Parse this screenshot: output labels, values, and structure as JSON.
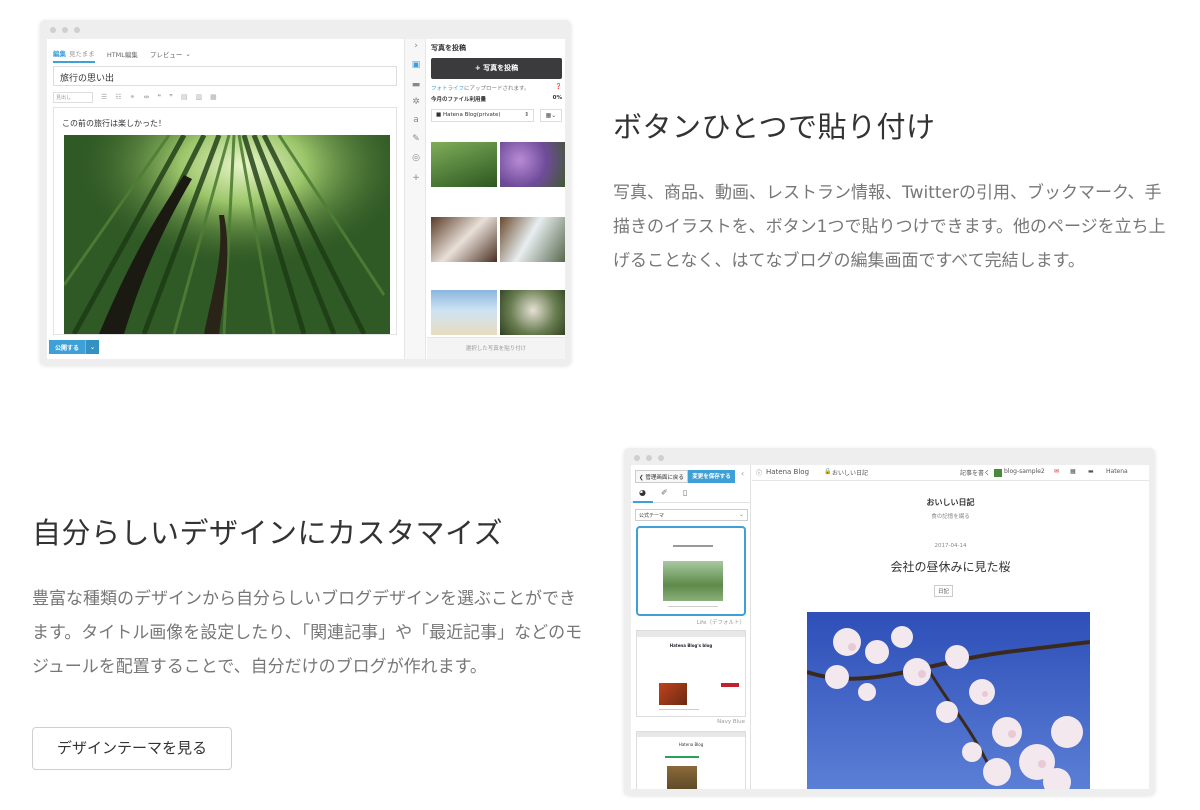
{
  "feature1": {
    "heading": "ボタンひとつで貼り付け",
    "body": "写真、商品、動画、レストラン情報、Twitterの引用、ブックマーク、手描きのイラストを、ボタン1つで貼りつけできます。他のページを立ち上げることなく、はてなブログの編集画面ですべて完結します。"
  },
  "feature2": {
    "heading": "自分らしいデザインにカスタマイズ",
    "body": "豊富な種類のデザインから自分らしいブログデザインを選ぶことができます。タイトル画像を設定したり、「関連記事」や「最近記事」などのモジュールを配置することで、自分だけのブログが作れます。",
    "button": "デザインテーマを見る"
  },
  "editor": {
    "tabs": [
      {
        "label": "編集",
        "sub": "見たまま"
      },
      {
        "label": "HTML編集"
      },
      {
        "label": "プレビュー"
      }
    ],
    "title_value": "旅行の思い出",
    "format_select": "見出し",
    "body_text": "この前の旅行は楽しかった！",
    "publish": "公開する",
    "side": {
      "title": "写真を投稿",
      "upload_button": "+ 写真を投稿",
      "note_link": "フォトライフ",
      "note_text": "にアップロードされます。",
      "usage_label": "今月のファイル利用量",
      "usage_value": "0%",
      "album": "Hatena Blog(private)",
      "paste_button": "選択した写真を貼り付け"
    }
  },
  "design": {
    "back_button": "管理画面に戻る",
    "save_button": "変更を保存する",
    "theme_select": "公式テーマ",
    "themes": [
      {
        "caption": "Life（デフォルト）"
      },
      {
        "caption": "Navy Blue",
        "header_text": "Hatena Blog's blog"
      },
      {
        "header_text": "Hatena Blog"
      }
    ],
    "topbar": {
      "brand": "Hatena Blog",
      "blog_name": "おいしい日記",
      "write": "記事を書く",
      "user": "blog-sample2",
      "hatena": "Hatena"
    },
    "preview": {
      "blog_title": "おいしい日記",
      "blog_subtitle": "食の記憶を綴る",
      "date": "2017-04-14",
      "entry_title": "会社の昼休みに見た桜",
      "category": "日記"
    }
  }
}
